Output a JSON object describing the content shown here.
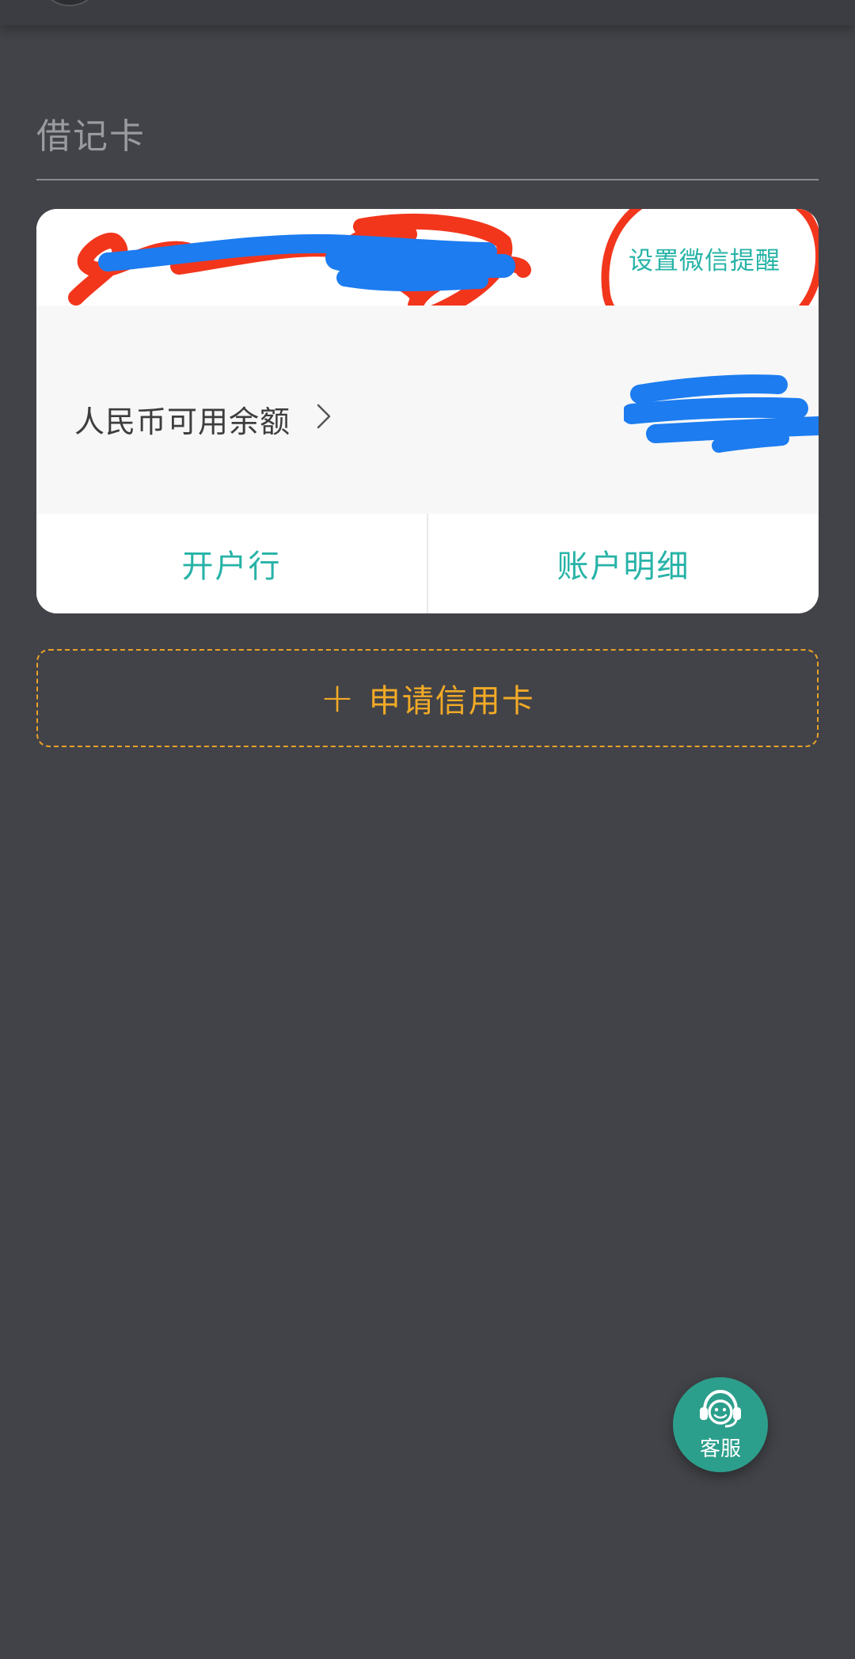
{
  "section": {
    "title": "借记卡"
  },
  "card": {
    "wechat_reminder": "设置微信提醒",
    "balance_label": "人民币可用余额",
    "actions": {
      "opening_bank": "开户行",
      "account_details": "账户明细"
    }
  },
  "apply": {
    "plus": "+",
    "label": "申请信用卡"
  },
  "customer_service": {
    "label": "客服",
    "icon": "headset-smile-icon"
  },
  "colors": {
    "background": "#424348",
    "accent_teal": "#27b3a7",
    "accent_orange": "#f2aa26",
    "annotation_red": "#f2361c",
    "annotation_blue": "#1c7cf0"
  }
}
